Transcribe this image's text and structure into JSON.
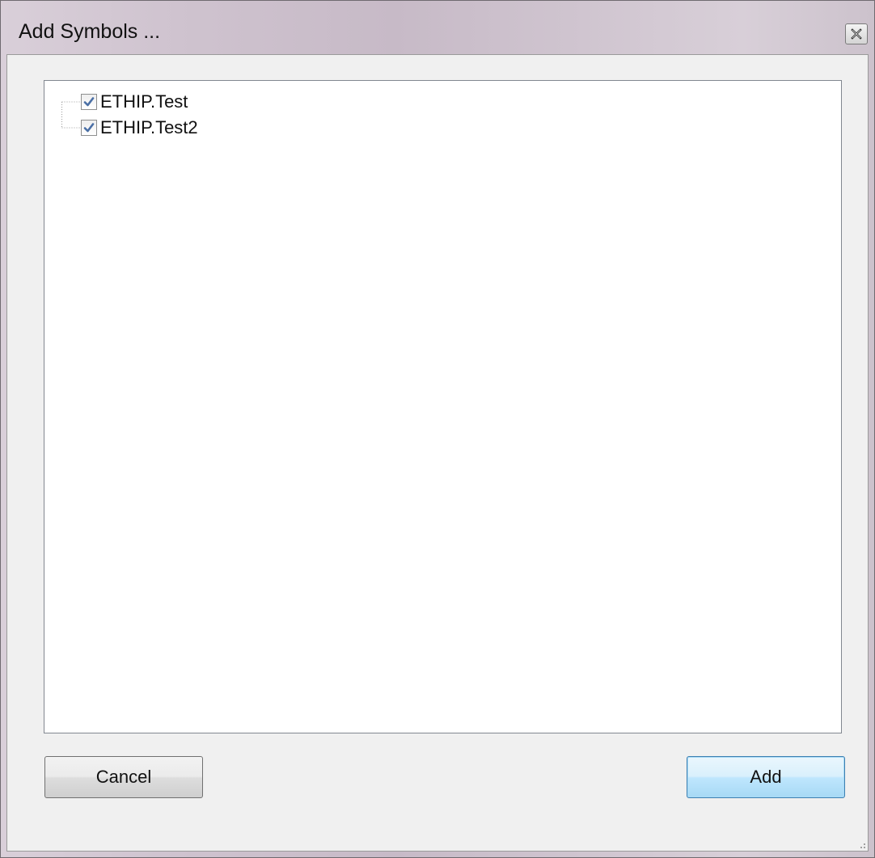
{
  "window": {
    "title": "Add Symbols ..."
  },
  "tree": {
    "items": [
      {
        "label": "ETHIP.Test",
        "checked": true
      },
      {
        "label": "ETHIP.Test2",
        "checked": true
      }
    ]
  },
  "buttons": {
    "cancel_label": "Cancel",
    "add_label": "Add"
  },
  "icons": {
    "close": "close-icon",
    "check": "check-icon",
    "grip": "resize-grip-icon"
  },
  "colors": {
    "check": "#4a6fa5",
    "default_button_border": "#3c7fb1"
  }
}
